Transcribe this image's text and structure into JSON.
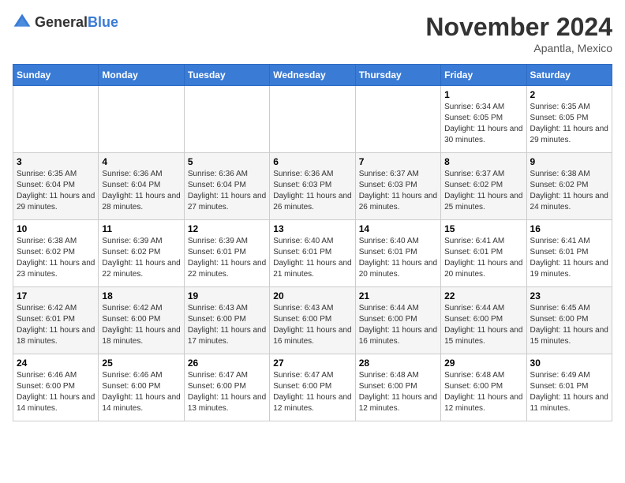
{
  "logo": {
    "text_general": "General",
    "text_blue": "Blue"
  },
  "header": {
    "month": "November 2024",
    "location": "Apantla, Mexico"
  },
  "weekdays": [
    "Sunday",
    "Monday",
    "Tuesday",
    "Wednesday",
    "Thursday",
    "Friday",
    "Saturday"
  ],
  "weeks": [
    [
      {
        "day": "",
        "info": ""
      },
      {
        "day": "",
        "info": ""
      },
      {
        "day": "",
        "info": ""
      },
      {
        "day": "",
        "info": ""
      },
      {
        "day": "",
        "info": ""
      },
      {
        "day": "1",
        "info": "Sunrise: 6:34 AM\nSunset: 6:05 PM\nDaylight: 11 hours and 30 minutes."
      },
      {
        "day": "2",
        "info": "Sunrise: 6:35 AM\nSunset: 6:05 PM\nDaylight: 11 hours and 29 minutes."
      }
    ],
    [
      {
        "day": "3",
        "info": "Sunrise: 6:35 AM\nSunset: 6:04 PM\nDaylight: 11 hours and 29 minutes."
      },
      {
        "day": "4",
        "info": "Sunrise: 6:36 AM\nSunset: 6:04 PM\nDaylight: 11 hours and 28 minutes."
      },
      {
        "day": "5",
        "info": "Sunrise: 6:36 AM\nSunset: 6:04 PM\nDaylight: 11 hours and 27 minutes."
      },
      {
        "day": "6",
        "info": "Sunrise: 6:36 AM\nSunset: 6:03 PM\nDaylight: 11 hours and 26 minutes."
      },
      {
        "day": "7",
        "info": "Sunrise: 6:37 AM\nSunset: 6:03 PM\nDaylight: 11 hours and 26 minutes."
      },
      {
        "day": "8",
        "info": "Sunrise: 6:37 AM\nSunset: 6:02 PM\nDaylight: 11 hours and 25 minutes."
      },
      {
        "day": "9",
        "info": "Sunrise: 6:38 AM\nSunset: 6:02 PM\nDaylight: 11 hours and 24 minutes."
      }
    ],
    [
      {
        "day": "10",
        "info": "Sunrise: 6:38 AM\nSunset: 6:02 PM\nDaylight: 11 hours and 23 minutes."
      },
      {
        "day": "11",
        "info": "Sunrise: 6:39 AM\nSunset: 6:02 PM\nDaylight: 11 hours and 22 minutes."
      },
      {
        "day": "12",
        "info": "Sunrise: 6:39 AM\nSunset: 6:01 PM\nDaylight: 11 hours and 22 minutes."
      },
      {
        "day": "13",
        "info": "Sunrise: 6:40 AM\nSunset: 6:01 PM\nDaylight: 11 hours and 21 minutes."
      },
      {
        "day": "14",
        "info": "Sunrise: 6:40 AM\nSunset: 6:01 PM\nDaylight: 11 hours and 20 minutes."
      },
      {
        "day": "15",
        "info": "Sunrise: 6:41 AM\nSunset: 6:01 PM\nDaylight: 11 hours and 20 minutes."
      },
      {
        "day": "16",
        "info": "Sunrise: 6:41 AM\nSunset: 6:01 PM\nDaylight: 11 hours and 19 minutes."
      }
    ],
    [
      {
        "day": "17",
        "info": "Sunrise: 6:42 AM\nSunset: 6:01 PM\nDaylight: 11 hours and 18 minutes."
      },
      {
        "day": "18",
        "info": "Sunrise: 6:42 AM\nSunset: 6:00 PM\nDaylight: 11 hours and 18 minutes."
      },
      {
        "day": "19",
        "info": "Sunrise: 6:43 AM\nSunset: 6:00 PM\nDaylight: 11 hours and 17 minutes."
      },
      {
        "day": "20",
        "info": "Sunrise: 6:43 AM\nSunset: 6:00 PM\nDaylight: 11 hours and 16 minutes."
      },
      {
        "day": "21",
        "info": "Sunrise: 6:44 AM\nSunset: 6:00 PM\nDaylight: 11 hours and 16 minutes."
      },
      {
        "day": "22",
        "info": "Sunrise: 6:44 AM\nSunset: 6:00 PM\nDaylight: 11 hours and 15 minutes."
      },
      {
        "day": "23",
        "info": "Sunrise: 6:45 AM\nSunset: 6:00 PM\nDaylight: 11 hours and 15 minutes."
      }
    ],
    [
      {
        "day": "24",
        "info": "Sunrise: 6:46 AM\nSunset: 6:00 PM\nDaylight: 11 hours and 14 minutes."
      },
      {
        "day": "25",
        "info": "Sunrise: 6:46 AM\nSunset: 6:00 PM\nDaylight: 11 hours and 14 minutes."
      },
      {
        "day": "26",
        "info": "Sunrise: 6:47 AM\nSunset: 6:00 PM\nDaylight: 11 hours and 13 minutes."
      },
      {
        "day": "27",
        "info": "Sunrise: 6:47 AM\nSunset: 6:00 PM\nDaylight: 11 hours and 12 minutes."
      },
      {
        "day": "28",
        "info": "Sunrise: 6:48 AM\nSunset: 6:00 PM\nDaylight: 11 hours and 12 minutes."
      },
      {
        "day": "29",
        "info": "Sunrise: 6:48 AM\nSunset: 6:00 PM\nDaylight: 11 hours and 12 minutes."
      },
      {
        "day": "30",
        "info": "Sunrise: 6:49 AM\nSunset: 6:01 PM\nDaylight: 11 hours and 11 minutes."
      }
    ]
  ]
}
